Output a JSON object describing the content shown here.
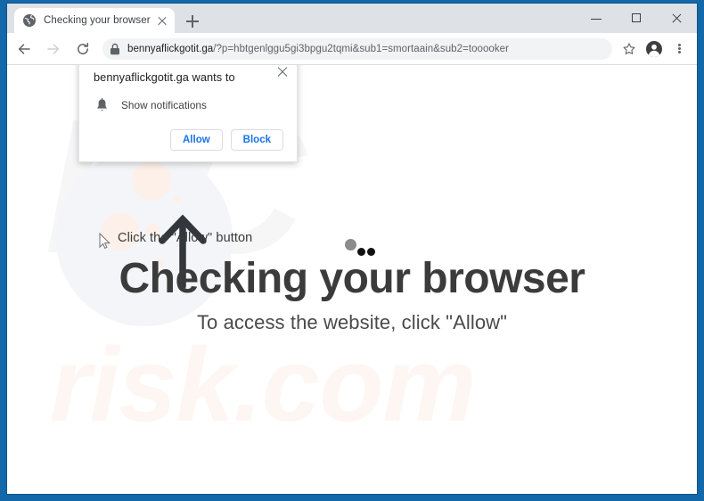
{
  "browser": {
    "tab": {
      "title": "Checking your browser",
      "favicon": "globe-icon",
      "close_label": "×"
    },
    "new_tab_label": "+",
    "window_controls": {
      "minimize": "–",
      "maximize": "□",
      "close": "×"
    },
    "toolbar": {
      "back": "back-arrow-icon",
      "forward": "forward-arrow-icon",
      "reload": "reload-icon",
      "bookmark": "star-icon",
      "profile": "account-avatar-icon",
      "menu": "three-dot-menu-icon"
    },
    "omnibox": {
      "lock": "lock-icon",
      "host": "bennyaflickgotit.ga",
      "path": "/?p=hbtgenlggu5gi3bpgu2tqmi&sub1=smortaain&sub2=tooooker",
      "full_url": "bennyaflickgotit.ga/?p=hbtgenlggu5gi3bpgu2tqmi&sub1=smortaain&sub2=tooooker"
    }
  },
  "permission_dialog": {
    "title": "bennyaflickgotit.ga wants to",
    "permission_icon": "bell-icon",
    "permission_label": "Show notifications",
    "allow_label": "Allow",
    "block_label": "Block",
    "close_label": "×"
  },
  "page": {
    "hint_text": "Click the \"Allow\" button",
    "arrow_icon": "up-arrow-icon",
    "cursor_icon": "mouse-pointer-icon",
    "loading_indicator": "three-dot-loader",
    "heading": "Checking your browser",
    "subheading": "To access the website, click \"Allow\"",
    "watermark_top": "PC",
    "watermark_bottom": "risk.com"
  },
  "colors": {
    "desktop": "#1268a8",
    "tabstrip": "#dee1e6",
    "accent_link": "#1a73e8",
    "heading": "#3b3b3b",
    "watermark_gray": "#f6f6f7",
    "watermark_pink": "#fdf6f3",
    "blob_blue": "#f3f5f8",
    "blob_peach": "#fdf0e8"
  }
}
